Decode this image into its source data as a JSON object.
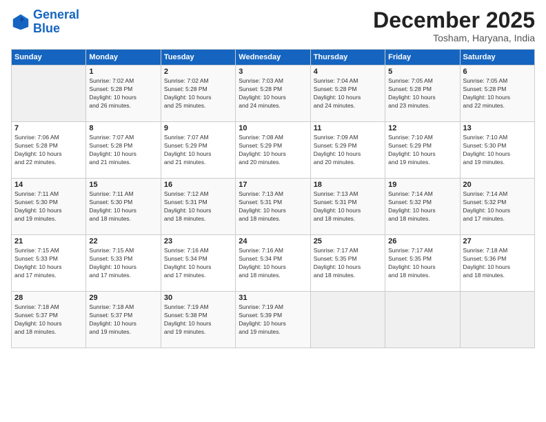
{
  "logo": {
    "line1": "General",
    "line2": "Blue"
  },
  "title": "December 2025",
  "location": "Tosham, Haryana, India",
  "headers": [
    "Sunday",
    "Monday",
    "Tuesday",
    "Wednesday",
    "Thursday",
    "Friday",
    "Saturday"
  ],
  "weeks": [
    [
      {
        "day": "",
        "info": ""
      },
      {
        "day": "1",
        "info": "Sunrise: 7:02 AM\nSunset: 5:28 PM\nDaylight: 10 hours\nand 26 minutes."
      },
      {
        "day": "2",
        "info": "Sunrise: 7:02 AM\nSunset: 5:28 PM\nDaylight: 10 hours\nand 25 minutes."
      },
      {
        "day": "3",
        "info": "Sunrise: 7:03 AM\nSunset: 5:28 PM\nDaylight: 10 hours\nand 24 minutes."
      },
      {
        "day": "4",
        "info": "Sunrise: 7:04 AM\nSunset: 5:28 PM\nDaylight: 10 hours\nand 24 minutes."
      },
      {
        "day": "5",
        "info": "Sunrise: 7:05 AM\nSunset: 5:28 PM\nDaylight: 10 hours\nand 23 minutes."
      },
      {
        "day": "6",
        "info": "Sunrise: 7:05 AM\nSunset: 5:28 PM\nDaylight: 10 hours\nand 22 minutes."
      }
    ],
    [
      {
        "day": "7",
        "info": "Sunrise: 7:06 AM\nSunset: 5:28 PM\nDaylight: 10 hours\nand 22 minutes."
      },
      {
        "day": "8",
        "info": "Sunrise: 7:07 AM\nSunset: 5:28 PM\nDaylight: 10 hours\nand 21 minutes."
      },
      {
        "day": "9",
        "info": "Sunrise: 7:07 AM\nSunset: 5:29 PM\nDaylight: 10 hours\nand 21 minutes."
      },
      {
        "day": "10",
        "info": "Sunrise: 7:08 AM\nSunset: 5:29 PM\nDaylight: 10 hours\nand 20 minutes."
      },
      {
        "day": "11",
        "info": "Sunrise: 7:09 AM\nSunset: 5:29 PM\nDaylight: 10 hours\nand 20 minutes."
      },
      {
        "day": "12",
        "info": "Sunrise: 7:10 AM\nSunset: 5:29 PM\nDaylight: 10 hours\nand 19 minutes."
      },
      {
        "day": "13",
        "info": "Sunrise: 7:10 AM\nSunset: 5:30 PM\nDaylight: 10 hours\nand 19 minutes."
      }
    ],
    [
      {
        "day": "14",
        "info": "Sunrise: 7:11 AM\nSunset: 5:30 PM\nDaylight: 10 hours\nand 19 minutes."
      },
      {
        "day": "15",
        "info": "Sunrise: 7:11 AM\nSunset: 5:30 PM\nDaylight: 10 hours\nand 18 minutes."
      },
      {
        "day": "16",
        "info": "Sunrise: 7:12 AM\nSunset: 5:31 PM\nDaylight: 10 hours\nand 18 minutes."
      },
      {
        "day": "17",
        "info": "Sunrise: 7:13 AM\nSunset: 5:31 PM\nDaylight: 10 hours\nand 18 minutes."
      },
      {
        "day": "18",
        "info": "Sunrise: 7:13 AM\nSunset: 5:31 PM\nDaylight: 10 hours\nand 18 minutes."
      },
      {
        "day": "19",
        "info": "Sunrise: 7:14 AM\nSunset: 5:32 PM\nDaylight: 10 hours\nand 18 minutes."
      },
      {
        "day": "20",
        "info": "Sunrise: 7:14 AM\nSunset: 5:32 PM\nDaylight: 10 hours\nand 17 minutes."
      }
    ],
    [
      {
        "day": "21",
        "info": "Sunrise: 7:15 AM\nSunset: 5:33 PM\nDaylight: 10 hours\nand 17 minutes."
      },
      {
        "day": "22",
        "info": "Sunrise: 7:15 AM\nSunset: 5:33 PM\nDaylight: 10 hours\nand 17 minutes."
      },
      {
        "day": "23",
        "info": "Sunrise: 7:16 AM\nSunset: 5:34 PM\nDaylight: 10 hours\nand 17 minutes."
      },
      {
        "day": "24",
        "info": "Sunrise: 7:16 AM\nSunset: 5:34 PM\nDaylight: 10 hours\nand 18 minutes."
      },
      {
        "day": "25",
        "info": "Sunrise: 7:17 AM\nSunset: 5:35 PM\nDaylight: 10 hours\nand 18 minutes."
      },
      {
        "day": "26",
        "info": "Sunrise: 7:17 AM\nSunset: 5:35 PM\nDaylight: 10 hours\nand 18 minutes."
      },
      {
        "day": "27",
        "info": "Sunrise: 7:18 AM\nSunset: 5:36 PM\nDaylight: 10 hours\nand 18 minutes."
      }
    ],
    [
      {
        "day": "28",
        "info": "Sunrise: 7:18 AM\nSunset: 5:37 PM\nDaylight: 10 hours\nand 18 minutes."
      },
      {
        "day": "29",
        "info": "Sunrise: 7:18 AM\nSunset: 5:37 PM\nDaylight: 10 hours\nand 19 minutes."
      },
      {
        "day": "30",
        "info": "Sunrise: 7:19 AM\nSunset: 5:38 PM\nDaylight: 10 hours\nand 19 minutes."
      },
      {
        "day": "31",
        "info": "Sunrise: 7:19 AM\nSunset: 5:39 PM\nDaylight: 10 hours\nand 19 minutes."
      },
      {
        "day": "",
        "info": ""
      },
      {
        "day": "",
        "info": ""
      },
      {
        "day": "",
        "info": ""
      }
    ]
  ]
}
